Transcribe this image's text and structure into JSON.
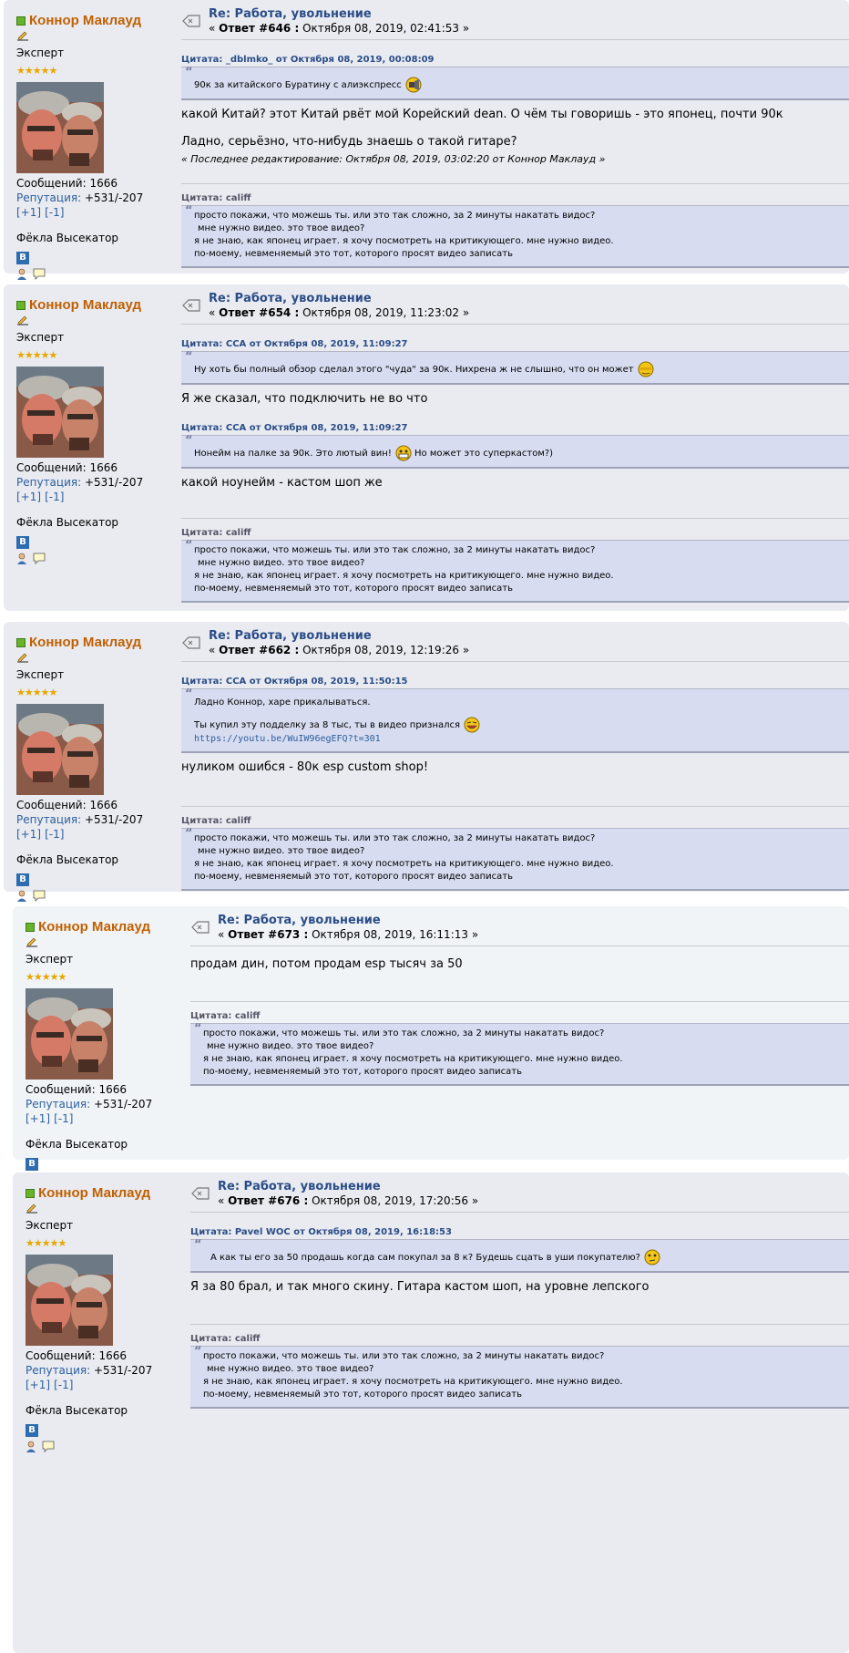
{
  "user": {
    "name": "Коннор Маклауд",
    "rank": "Эксперт",
    "stars": "★★★★★",
    "posts_label": "Сообщений: 1666",
    "rep_label": "Репутация:",
    "rep_value": "+531/-207",
    "karma_plus": "[+1]",
    "karma_minus": "[-1]",
    "signature_name": "Фёкла Высекатор",
    "vk_letter": "B"
  },
  "signature": {
    "header": "Цитата: califf",
    "lines": [
      "просто покажи, что можешь ты. или это так сложно, за 2 минуты накатать видос?",
      "мне нужно видео. это твое видео?",
      "я не знаю, как японец играет. я хочу посмотреть на критикующего. мне нужно видео.",
      "по-моему, невменяемый это тот, которого просят видео записать"
    ]
  },
  "posts": [
    {
      "subject": "Re: Работа, увольнение",
      "reply_label": "Ответ #646 :",
      "date": "Октября 08, 2019, 02:41:53 »",
      "quotes": [
        {
          "header": "Цитата: _dblmko_ от Октября 08, 2019, 00:08:09",
          "text": "90к за китайского Буратину с алиэкспресс"
        }
      ],
      "texts": [
        "какой Китай? этот Китай рвёт мой Корейский dean.  О чём ты говоришь - это японец, почти 90к",
        "Ладно, серьёзно, что-нибудь знаешь о такой гитаре?"
      ],
      "edited": "« Последнее редактирование: Октября 08, 2019, 03:02:20 от Коннор Маклауд »"
    },
    {
      "subject": "Re: Работа, увольнение",
      "reply_label": "Ответ #654 :",
      "date": "Октября 08, 2019, 11:23:02 »",
      "quote1_header": "Цитата: CCA от Октября 08, 2019, 11:09:27",
      "quote1_text": "Ну хоть бы полный обзор сделал этого \"чуда\" за 90к. Нихрена ж не слышно, что он может",
      "text1": "Я же сказал, что подключить не во что",
      "quote2_header": "Цитата: CCA от Октября 08, 2019, 11:09:27",
      "quote2_text": "Нонейм на палке за 90к. Это лютый вин!",
      "quote2_text_after": "Но может это суперкастом?)",
      "text2": "какой ноунейм - кастом шоп же"
    },
    {
      "subject": "Re: Работа, увольнение",
      "reply_label": "Ответ #662 :",
      "date": "Октября 08, 2019, 12:19:26 »",
      "quote_header": "Цитата: CCA от Октября 08, 2019, 11:50:15",
      "quote_line1": "Ладно Коннор, харе прикалываться.",
      "quote_line2": "Ты купил эту подделку за 8 тыс, ты в видео признался",
      "quote_link": "https://youtu.be/WuIW96egEFQ?t=301",
      "text": "нуликом ошибся - 80к esp custom shop!"
    },
    {
      "subject": "Re: Работа, увольнение",
      "reply_label": "Ответ #673 :",
      "date": "Октября 08, 2019, 16:11:13 »",
      "text": "продам дин, потом продам esp тысяч за 50"
    },
    {
      "subject": "Re: Работа, увольнение",
      "reply_label": "Ответ #676 :",
      "date": "Октября 08, 2019, 17:20:56 »",
      "quote_header": "Цитата: Pavel WOC от Октября 08, 2019, 16:18:53",
      "quote_text": "А как ты его за 50 продашь когда сам покупал за 8 к? Будешь сцать в уши покупателю?",
      "text": "Я за 80 брал, и так много скину. Гитара кастом шоп, на уровне лепского"
    }
  ],
  "colors": {
    "username": "#c06002",
    "subject": "#2a4d88",
    "post_bg": "#e9ebf0",
    "quote_bg": "#d7dcf0",
    "online": "#67b32a"
  },
  "icons": [
    "online-status-icon",
    "pencil-icon",
    "avatar",
    "vk-icon",
    "profile-icon",
    "message-icon",
    "topic-icon",
    "smiley-icon"
  ]
}
